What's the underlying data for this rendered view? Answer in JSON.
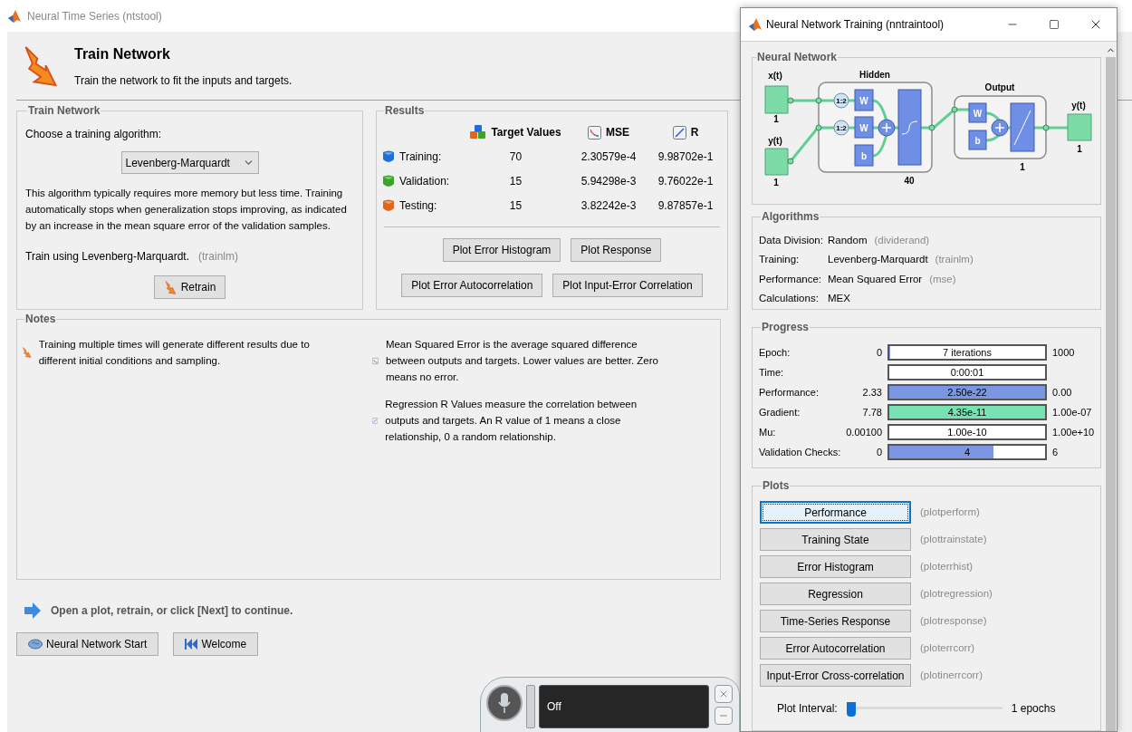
{
  "main_window": {
    "title": "Neural Time Series (ntstool)",
    "header": {
      "title": "Train Network",
      "subtitle": "Train the network to fit the inputs and targets."
    },
    "train_panel": {
      "legend": "Train Network",
      "prompt": "Choose a training algorithm:",
      "algorithm_select": {
        "value": "Levenberg-Marquardt"
      },
      "description": "This algorithm typically requires more memory but less time. Training automatically stops when generalization stops improving, as indicated by an increase in the mean square error of the validation samples.",
      "train_using": "Train using Levenberg-Marquardt.",
      "train_using_function": "(trainlm)",
      "retrain_button": "Retrain"
    },
    "results_panel": {
      "legend": "Results",
      "columns": [
        {
          "label": "Target Values",
          "kind": "targets"
        },
        {
          "label": "MSE",
          "kind": "mse"
        },
        {
          "label": "R",
          "kind": "r"
        }
      ],
      "rows": [
        {
          "label": "Training:",
          "color": "#1f6fd6",
          "values": [
            "70",
            "2.30579e-4",
            "9.98702e-1"
          ]
        },
        {
          "label": "Validation:",
          "color": "#3aa52a",
          "values": [
            "15",
            "5.94298e-3",
            "9.76022e-1"
          ]
        },
        {
          "label": "Testing:",
          "color": "#e0661a",
          "values": [
            "15",
            "3.82242e-3",
            "9.87857e-1"
          ]
        }
      ],
      "button_rows": [
        {
          "buttons": [
            "Plot Error Histogram",
            "Plot Response"
          ]
        },
        {
          "buttons": [
            "Plot Error Autocorrelation",
            "Plot Input-Error Correlation"
          ]
        }
      ]
    },
    "notes": {
      "legend": "Notes",
      "items": [
        {
          "kind": "retrain",
          "text": "Training multiple times will generate different results due to different initial conditions and sampling."
        },
        {
          "kind": "mse",
          "text": "Mean Squared Error is the average squared difference between outputs and targets. Lower values are better. Zero means no error."
        },
        {
          "kind": "r",
          "text": "Regression R Values measure the correlation between outputs and targets. An R value of 1 means a close relationship, 0 a random relationship."
        }
      ]
    },
    "hint": "Open a plot, retrain, or click [Next] to continue.",
    "nav_buttons": [
      {
        "label": "Neural Network Start",
        "kind": "start"
      },
      {
        "label": "Welcome",
        "kind": "welcome"
      }
    ]
  },
  "training_window": {
    "title": "Neural Network Training (nntraintool)",
    "network_panel": {
      "legend": "Neural Network",
      "diagram": {
        "inputs": [
          {
            "name": "x(t)",
            "size": "1"
          },
          {
            "name": "y(t)",
            "size": "1"
          }
        ],
        "hidden": {
          "title": "Hidden",
          "size": "40",
          "delays": [
            "1:2",
            "1:2"
          ],
          "weights": [
            "W",
            "W"
          ],
          "bias": "b"
        },
        "output_layer": {
          "title": "Output",
          "size": "1",
          "weight": "W",
          "bias": "b"
        },
        "output": {
          "name": "y(t)",
          "size": "1"
        }
      }
    },
    "algorithms": {
      "legend": "Algorithms",
      "rows": [
        {
          "label": "Data Division:",
          "value": "Random",
          "function": "(dividerand)"
        },
        {
          "label": "Training:",
          "value": "Levenberg-Marquardt",
          "function": "(trainlm)"
        },
        {
          "label": "Performance:",
          "value": "Mean Squared Error",
          "function": "(mse)"
        },
        {
          "label": "Calculations:",
          "value": "MEX"
        }
      ]
    },
    "progress": {
      "legend": "Progress",
      "rows": [
        {
          "label": "Epoch:",
          "start": "0",
          "bar_text": "7 iterations",
          "end": "1000",
          "level": 0.007,
          "color": "#7b96e2"
        },
        {
          "label": "Time:",
          "bar_text": "0:00:01",
          "level": 0
        },
        {
          "label": "Performance:",
          "start": "2.33",
          "bar_text": "2.50e-22",
          "end": "0.00",
          "level": 1,
          "color": "#7b96e2"
        },
        {
          "label": "Gradient:",
          "start": "7.78",
          "bar_text": "4.35e-11",
          "end": "1.00e-07",
          "level": 1,
          "color": "#78e2b2"
        },
        {
          "label": "Mu:",
          "start": "0.00100",
          "bar_text": "1.00e-10",
          "end": "1.00e+10",
          "level": 0
        },
        {
          "label": "Validation Checks:",
          "start": "0",
          "bar_text": "4",
          "end": "6",
          "level": 0.667,
          "color": "#7b96e2"
        }
      ]
    },
    "plots": {
      "legend": "Plots",
      "buttons": [
        {
          "label": "Performance",
          "function": "(plotperform)",
          "focused": true
        },
        {
          "label": "Training State",
          "function": "(plottrainstate)",
          "focused": false
        },
        {
          "label": "Error Histogram",
          "function": "(ploterrhist)",
          "focused": false
        },
        {
          "label": "Regression",
          "function": "(plotregression)",
          "focused": false
        },
        {
          "label": "Time-Series Response",
          "function": "(plotresponse)",
          "focused": false
        },
        {
          "label": "Error Autocorrelation",
          "function": "(ploterrcorr)",
          "focused": false
        },
        {
          "label": "Input-Error Cross-correlation",
          "function": "(plotinerrcorr)",
          "focused": false
        }
      ],
      "interval": {
        "label": "Plot Interval:",
        "level": 0,
        "reading": "1 epochs"
      }
    }
  },
  "speech_widget": {
    "status": "Off"
  }
}
